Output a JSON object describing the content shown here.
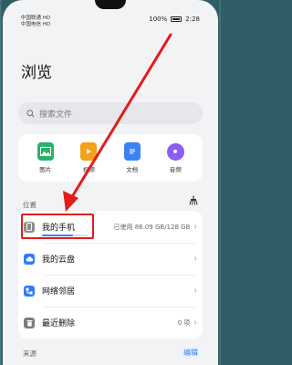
{
  "status_bar": {
    "carrier_line1": "中国联通 HD",
    "carrier_line2": "中国电信 HD",
    "battery_pct": "100%",
    "time": "2:28"
  },
  "page": {
    "title": "浏览"
  },
  "search": {
    "placeholder": "搜索文件"
  },
  "categories": [
    {
      "label": "图片",
      "icon": "image-icon",
      "color": "#27b26b"
    },
    {
      "label": "视频",
      "icon": "video-icon",
      "color": "#f4a11b"
    },
    {
      "label": "文档",
      "icon": "document-icon",
      "color": "#3b82f6"
    },
    {
      "label": "音频",
      "icon": "audio-icon",
      "color": "#8b5cf6"
    }
  ],
  "locations": {
    "section_label": "位置",
    "items": [
      {
        "title": "我的手机",
        "detail": "已使用 86.09 GB/128 GB",
        "icon": "phone-icon",
        "storage_used_fraction": 0.67
      },
      {
        "title": "我的云盘",
        "detail": "",
        "icon": "cloud-icon"
      },
      {
        "title": "网络邻居",
        "detail": "",
        "icon": "network-icon"
      },
      {
        "title": "最近删除",
        "detail": "0 项",
        "icon": "trash-icon"
      }
    ]
  },
  "sources": {
    "section_label": "来源",
    "edit_label": "编辑"
  },
  "annotation": {
    "highlight_color": "#e31b1b"
  }
}
